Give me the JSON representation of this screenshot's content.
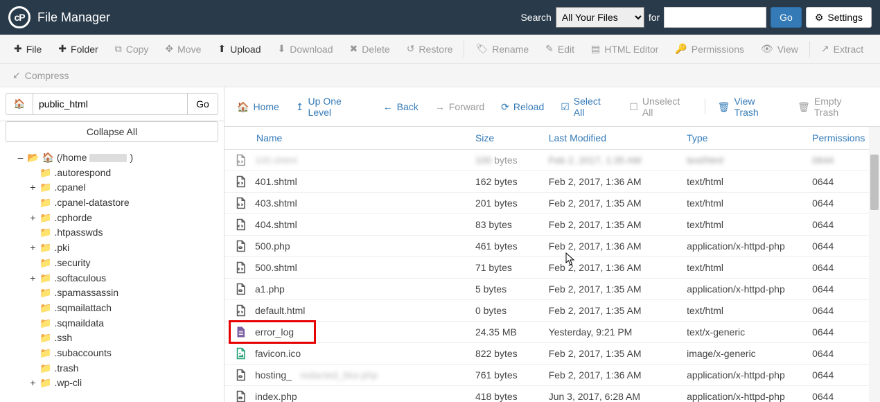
{
  "header": {
    "title": "File Manager",
    "search_label": "Search",
    "search_scope": "All Your Files",
    "for_label": "for",
    "search_value": "",
    "go": "Go",
    "settings": "Settings"
  },
  "toolbar": {
    "file": "File",
    "folder": "Folder",
    "copy": "Copy",
    "move": "Move",
    "upload": "Upload",
    "download": "Download",
    "delete": "Delete",
    "restore": "Restore",
    "rename": "Rename",
    "edit": "Edit",
    "html_editor": "HTML Editor",
    "permissions": "Permissions",
    "view": "View",
    "extract": "Extract",
    "compress": "Compress"
  },
  "sidebar": {
    "path": "public_html",
    "go": "Go",
    "collapse_all": "Collapse All",
    "root_prefix": "(/home",
    "root_suffix": ")",
    "items": [
      {
        "label": ".autorespond",
        "expander": ""
      },
      {
        "label": ".cpanel",
        "expander": "+"
      },
      {
        "label": ".cpanel-datastore",
        "expander": ""
      },
      {
        "label": ".cphorde",
        "expander": "+"
      },
      {
        "label": ".htpasswds",
        "expander": ""
      },
      {
        "label": ".pki",
        "expander": "+"
      },
      {
        "label": ".security",
        "expander": ""
      },
      {
        "label": ".softaculous",
        "expander": "+"
      },
      {
        "label": ".spamassassin",
        "expander": ""
      },
      {
        "label": ".sqmailattach",
        "expander": ""
      },
      {
        "label": ".sqmaildata",
        "expander": ""
      },
      {
        "label": ".ssh",
        "expander": ""
      },
      {
        "label": ".subaccounts",
        "expander": ""
      },
      {
        "label": ".trash",
        "expander": ""
      },
      {
        "label": ".wp-cli",
        "expander": "+"
      }
    ]
  },
  "actionbar": {
    "home": "Home",
    "up": "Up One Level",
    "back": "Back",
    "forward": "Forward",
    "reload": "Reload",
    "select_all": "Select All",
    "unselect_all": "Unselect All",
    "view_trash": "View Trash",
    "empty_trash": "Empty Trash"
  },
  "table": {
    "headers": {
      "name": "Name",
      "size": "Size",
      "modified": "Last Modified",
      "type": "Type",
      "permissions": "Permissions"
    },
    "rows": [
      {
        "icon": "code",
        "name": "401.shtml",
        "size": "162 bytes",
        "modified": "Feb 2, 2017, 1:36 AM",
        "type": "text/html",
        "perm": "0644"
      },
      {
        "icon": "code",
        "name": "403.shtml",
        "size": "201 bytes",
        "modified": "Feb 2, 2017, 1:35 AM",
        "type": "text/html",
        "perm": "0644"
      },
      {
        "icon": "code",
        "name": "404.shtml",
        "size": "83 bytes",
        "modified": "Feb 2, 2017, 1:35 AM",
        "type": "text/html",
        "perm": "0644"
      },
      {
        "icon": "php",
        "name": "500.php",
        "size": "461 bytes",
        "modified": "Feb 2, 2017, 1:36 AM",
        "type": "application/x-httpd-php",
        "perm": "0644"
      },
      {
        "icon": "code",
        "name": "500.shtml",
        "size": "71 bytes",
        "modified": "Feb 2, 2017, 1:36 AM",
        "type": "text/html",
        "perm": "0644"
      },
      {
        "icon": "php",
        "name": "a1.php",
        "size": "5 bytes",
        "modified": "Feb 2, 2017, 1:35 AM",
        "type": "application/x-httpd-php",
        "perm": "0644"
      },
      {
        "icon": "code",
        "name": "default.html",
        "size": "0 bytes",
        "modified": "Feb 2, 2017, 1:35 AM",
        "type": "text/html",
        "perm": "0644"
      },
      {
        "icon": "doc",
        "name": "error_log",
        "size": "24.35 MB",
        "modified": "Yesterday, 9:21 PM",
        "type": "text/x-generic",
        "perm": "0644",
        "highlight": true
      },
      {
        "icon": "img",
        "name": "favicon.ico",
        "size": "822 bytes",
        "modified": "Feb 2, 2017, 1:35 AM",
        "type": "image/x-generic",
        "perm": "0644"
      },
      {
        "icon": "php",
        "name": "hosting_",
        "size": "761 bytes",
        "modified": "Feb 2, 2017, 1:36 AM",
        "type": "application/x-httpd-php",
        "perm": "0644",
        "blur": true
      },
      {
        "icon": "php",
        "name": "index.php",
        "size": "418 bytes",
        "modified": "Jun 3, 2017, 6:28 AM",
        "type": "application/x-httpd-php",
        "perm": "0644"
      }
    ],
    "cut_row": {
      "size_suffix": "bytes"
    }
  }
}
